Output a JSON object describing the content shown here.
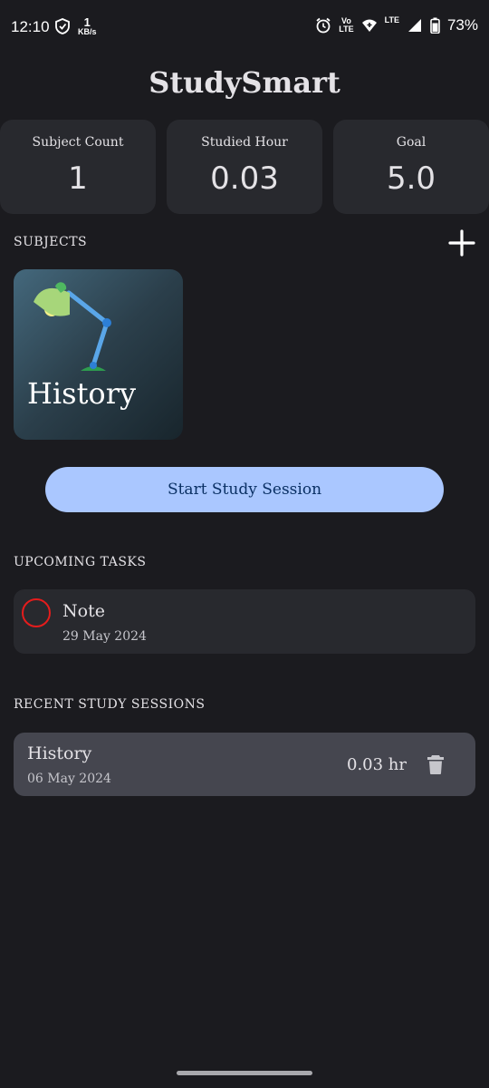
{
  "status_bar": {
    "time": "12:10",
    "net_speed_value": "1",
    "net_speed_unit": "KB/s",
    "volte_top": "Vo",
    "volte_bottom": "LTE",
    "lte": "LTE",
    "battery": "73%"
  },
  "app": {
    "title": "StudySmart"
  },
  "stats": [
    {
      "label": "Subject Count",
      "value": "1"
    },
    {
      "label": "Studied Hour",
      "value": "0.03"
    },
    {
      "label": "Goal",
      "value": "5.0"
    }
  ],
  "subjects": {
    "heading": "SUBJECTS",
    "items": [
      {
        "name": "History"
      }
    ]
  },
  "start_button": {
    "label": "Start Study Session"
  },
  "tasks": {
    "heading": "UPCOMING TASKS",
    "items": [
      {
        "title": "Note",
        "date": "29 May 2024",
        "priority_color": "#e51c1c"
      }
    ]
  },
  "sessions": {
    "heading": "RECENT STUDY SESSIONS",
    "items": [
      {
        "subject": "History",
        "date": "06 May 2024",
        "duration": "0.03 hr"
      }
    ]
  },
  "colors": {
    "background": "#1b1b1f",
    "card": "#28292e",
    "session_card": "#45464f",
    "primary_button": "#aac7ff"
  },
  "icons": [
    "shield-icon",
    "alarm-icon",
    "wifi-icon",
    "signal-icon",
    "battery-icon",
    "add-icon",
    "desk-lamp-icon",
    "delete-icon"
  ]
}
